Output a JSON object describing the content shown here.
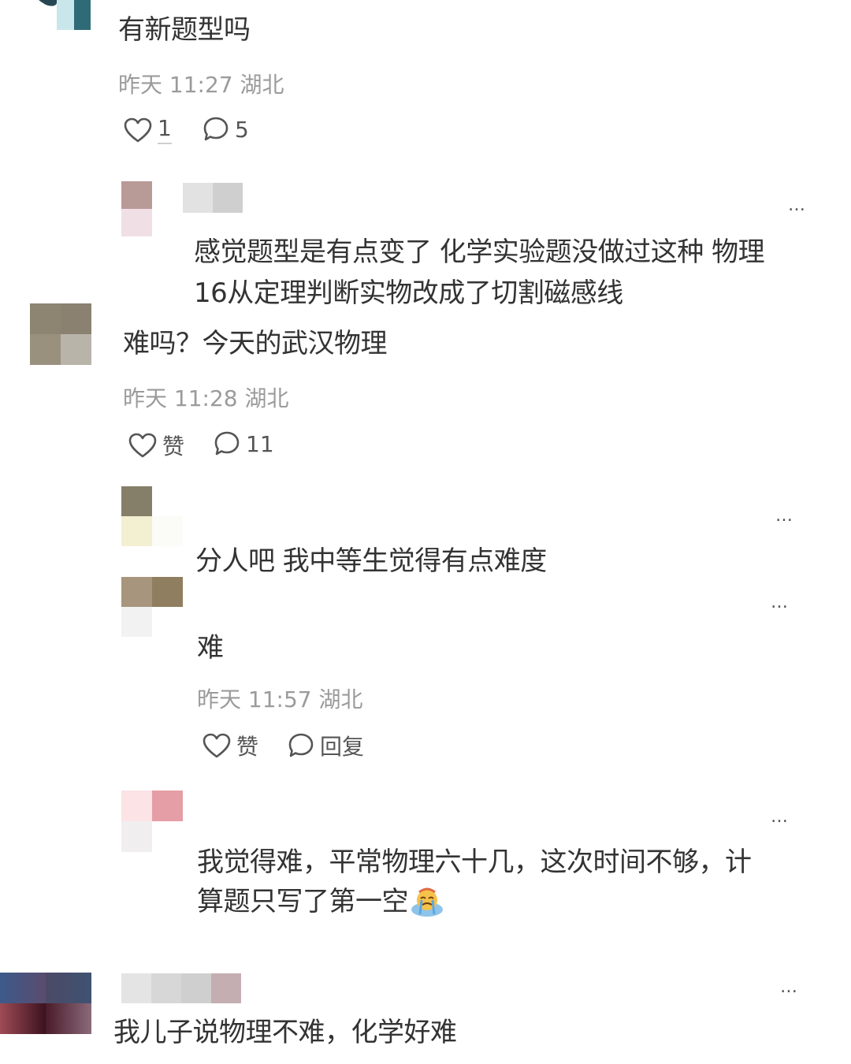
{
  "comments": [
    {
      "text": "有新题型吗",
      "time": "昨天 11:27",
      "location": "湖北",
      "like_label": "1",
      "reply_label": "5"
    },
    {
      "text": "感觉题型是有点变了 化学实验题没做过这种 物理",
      "text_line2": "16从定理判断实物改成了切割磁感线",
      "more": "…"
    },
    {
      "text": "难吗？今天的武汉物理",
      "time": "昨天 11:28",
      "location": "湖北",
      "like_label": "赞",
      "reply_label": "11"
    },
    {
      "text": "分人吧 我中等生觉得有点难度",
      "more": "…"
    },
    {
      "text": "难",
      "time": "昨天 11:57",
      "location": "湖北",
      "like_label": "赞",
      "reply_label": "回复",
      "more": "…"
    },
    {
      "text": "我觉得难，平常物理六十几，这次时间不够，计",
      "text_line2": "算题只写了第一空",
      "emoji": "crying-emoji",
      "more": "…"
    },
    {
      "text": "我儿子说物理不难，化学好难",
      "more": "…"
    }
  ],
  "icons": {
    "like": "heart-outline-icon",
    "reply": "speech-bubble-icon",
    "more": "ellipsis-icon"
  },
  "colors": {
    "text": "#333333",
    "meta": "#9b9b9b",
    "background": "#ffffff"
  }
}
